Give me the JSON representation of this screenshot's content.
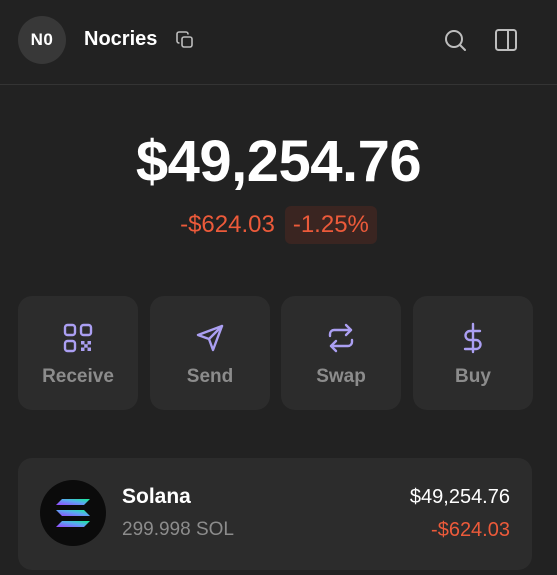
{
  "header": {
    "avatar_initials": "N0",
    "account_name": "Nocries",
    "icons": [
      "copy-icon",
      "search-icon",
      "sidebar-panel-icon"
    ]
  },
  "portfolio": {
    "balance": "$49,254.76",
    "change_amount": "-$624.03",
    "change_percent": "-1.25%"
  },
  "actions": [
    {
      "label": "Receive",
      "icon": "qr-code-icon"
    },
    {
      "label": "Send",
      "icon": "send-icon"
    },
    {
      "label": "Swap",
      "icon": "swap-icon"
    },
    {
      "label": "Buy",
      "icon": "dollar-icon"
    }
  ],
  "tokens": [
    {
      "name": "Solana",
      "amount": "299.998 SOL",
      "value": "$49,254.76",
      "change": "-$624.03",
      "icon": "solana-logo-icon"
    }
  ],
  "colors": {
    "background": "#222222",
    "card": "#2c2c2c",
    "accent": "#ab9ff2",
    "negative": "#ec5a3a",
    "muted_text": "#8c8c8c"
  }
}
